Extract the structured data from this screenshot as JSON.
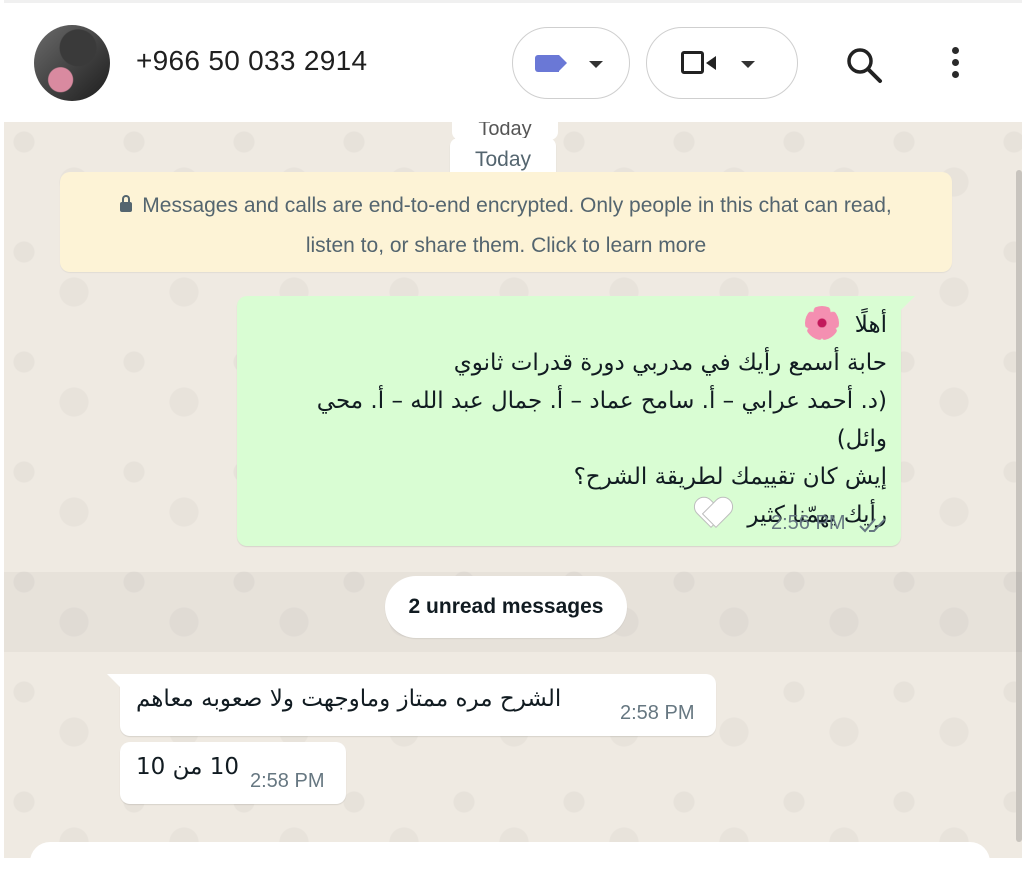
{
  "header": {
    "contact_name": "+966 50 033 2914",
    "avatar_icon": "contact-avatar",
    "labels_icon": "label-tag-icon",
    "video_icon": "video-camera-icon",
    "search_icon": "search-icon",
    "menu_icon": "kebab-menu-icon"
  },
  "chat": {
    "date_ghost": "Today",
    "date_chip": "Today",
    "encryption_notice": "Messages and calls are end-to-end encrypted. Only people in this chat can read, listen to, or share them. Click to learn more",
    "outgoing": {
      "line1": "أهلًا",
      "line2": "حابة أسمع رأيك في مدربي دورة قدرات ثانوي",
      "line3": "(د. أحمد عرابي – أ. سامح عماد – أ. جمال عبد الله – أ. محي وائل)",
      "line4": "إيش كان تقييمك لطريقة الشرح؟",
      "line5": "رأيك يهمّنا كثير",
      "time": "2:56 PM",
      "status": "read"
    },
    "unread_label": "2 unread messages",
    "incoming": [
      {
        "text": "الشرح مره ممتاز وماوجهت ولا صعوبه معاهم",
        "time": "2:58 PM"
      },
      {
        "text": "10 من 10",
        "time": "2:58 PM"
      }
    ]
  },
  "colors": {
    "outgoing_bubble": "#d9fdd3",
    "incoming_bubble": "#ffffff",
    "chat_background": "#efeae2",
    "encryption_banner": "#fdf3d6",
    "label_accent": "#6a78d6"
  }
}
